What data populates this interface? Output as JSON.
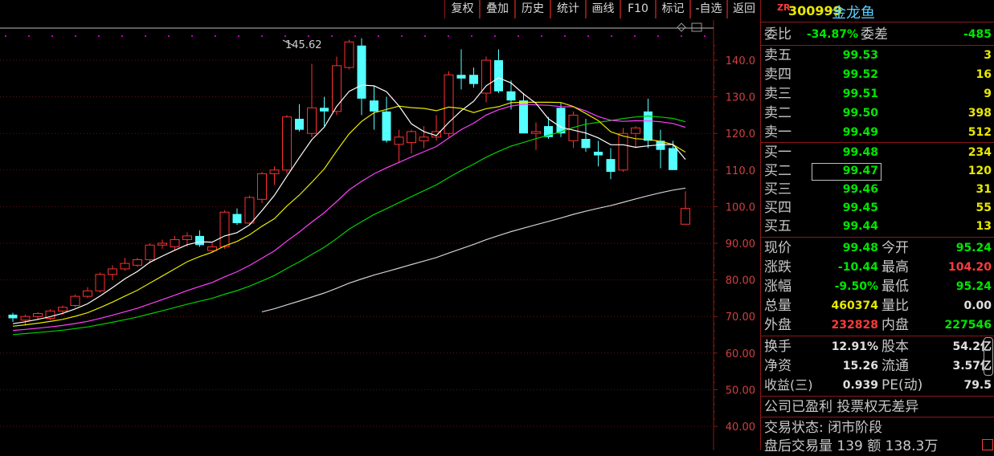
{
  "toolbar": {
    "buttons": [
      {
        "label": "复权",
        "name": "fuquan-button"
      },
      {
        "label": "叠加",
        "name": "diejia-button"
      },
      {
        "label": "历史",
        "name": "lishi-button"
      },
      {
        "label": "统计",
        "name": "tongji-button"
      },
      {
        "label": "画线",
        "name": "huaxian-button"
      },
      {
        "label": "F10",
        "name": "f10-button"
      },
      {
        "label": "标记",
        "name": "biaoji-button"
      },
      {
        "label": "-自选",
        "name": "zixuan-button"
      },
      {
        "label": "返回",
        "name": "fanhui-button"
      }
    ]
  },
  "stock": {
    "tag": "ZR",
    "code": "300999",
    "name": "金龙鱼"
  },
  "order_book": {
    "ratio_label": "委比",
    "ratio_value": "-34.87%",
    "diff_label": "委差",
    "diff_value": "-485",
    "asks": [
      {
        "label": "卖五",
        "price": "99.53",
        "vol": "3"
      },
      {
        "label": "卖四",
        "price": "99.52",
        "vol": "16"
      },
      {
        "label": "卖三",
        "price": "99.51",
        "vol": "9"
      },
      {
        "label": "卖二",
        "price": "99.50",
        "vol": "398"
      },
      {
        "label": "卖一",
        "price": "99.49",
        "vol": "512"
      }
    ],
    "bids": [
      {
        "label": "买一",
        "price": "99.48",
        "vol": "234"
      },
      {
        "label": "买二",
        "price": "99.47",
        "vol": "120"
      },
      {
        "label": "买三",
        "price": "99.46",
        "vol": "31"
      },
      {
        "label": "买四",
        "price": "99.45",
        "vol": "55"
      },
      {
        "label": "买五",
        "price": "99.44",
        "vol": "13"
      }
    ]
  },
  "quote": {
    "rows": [
      {
        "l1": "现价",
        "v1": "99.48",
        "l2": "今开",
        "v2": "95.24"
      },
      {
        "l1": "涨跌",
        "v1": "-10.44",
        "l2": "最高",
        "v2": "104.20"
      },
      {
        "l1": "涨幅",
        "v1": "-9.50%",
        "l2": "最低",
        "v2": "95.24"
      },
      {
        "l1": "总量",
        "v1": "460374",
        "l2": "量比",
        "v2": "0.00"
      },
      {
        "l1": "外盘",
        "v1": "232828",
        "l2": "内盘",
        "v2": "227546"
      }
    ],
    "rows2": [
      {
        "l1": "换手",
        "v1": "12.91%",
        "l2": "股本",
        "v2": "54.2亿"
      },
      {
        "l1": "净资",
        "v1": "15.26",
        "l2": "流通",
        "v2": "3.57亿"
      },
      {
        "l1": "收益(三)",
        "v1": "0.939",
        "l2": "PE(动)",
        "v2": "79.5"
      }
    ],
    "info1": "公司已盈利 投票权无差异",
    "info2": "交易状态: 闭市阶段",
    "info3": "盘后交易量 139 额 138.3万"
  },
  "chart_data": {
    "type": "candlestick",
    "y_ticks": [
      "140.0",
      "130.0",
      "120.0",
      "110.0",
      "100.0",
      "90.00",
      "80.00",
      "70.00",
      "60.00",
      "50.00",
      "40.00"
    ],
    "y_tick_values": [
      140,
      130,
      120,
      110,
      100,
      90,
      80,
      70,
      60,
      50,
      40
    ],
    "ylim": [
      36.5,
      150
    ],
    "high_label": "145.62",
    "colors": {
      "up": "#ff3030",
      "down": "#54ffff",
      "ma5": "#ffffff",
      "ma10": "#e8e800",
      "ma20": "#ff40ff",
      "ma30": "#00d000",
      "ma60": "#d0d0d0"
    },
    "candles": [
      [
        70.5,
        71.0,
        68.5,
        69.5
      ],
      [
        69.0,
        70.5,
        67.5,
        70.0
      ],
      [
        70.0,
        71.2,
        69.0,
        70.8
      ],
      [
        69.5,
        72.0,
        69.0,
        71.5
      ],
      [
        71.5,
        73.0,
        70.5,
        72.5
      ],
      [
        73.0,
        76.0,
        72.5,
        75.5
      ],
      [
        75.5,
        78.0,
        75.0,
        77.0
      ],
      [
        77.0,
        82.0,
        76.5,
        81.5
      ],
      [
        81.5,
        84.0,
        80.0,
        83.0
      ],
      [
        83.0,
        86.0,
        82.5,
        84.5
      ],
      [
        84.0,
        86.0,
        83.5,
        85.5
      ],
      [
        85.5,
        90.0,
        84.5,
        89.5
      ],
      [
        89.5,
        91.0,
        88.5,
        90.0
      ],
      [
        89.0,
        92.0,
        88.0,
        91.0
      ],
      [
        91.0,
        93.0,
        89.0,
        92.0
      ],
      [
        92.0,
        93.5,
        89.0,
        89.5
      ],
      [
        88.0,
        90.0,
        87.5,
        89.0
      ],
      [
        89.0,
        99.0,
        88.5,
        98.5
      ],
      [
        98.0,
        99.5,
        95.0,
        95.5
      ],
      [
        95.5,
        103.0,
        95.0,
        102.5
      ],
      [
        102.0,
        109.5,
        101.0,
        109.0
      ],
      [
        109.0,
        111.0,
        106.0,
        110.0
      ],
      [
        110.0,
        125.0,
        109.0,
        124.5
      ],
      [
        124.0,
        128.0,
        120.5,
        121.0
      ],
      [
        120.0,
        139.0,
        119.0,
        127.0
      ],
      [
        127.0,
        130.0,
        122.0,
        126.0
      ],
      [
        126.0,
        141.0,
        125.0,
        138.5
      ],
      [
        138.0,
        145.6,
        137.5,
        145.0
      ],
      [
        144.0,
        146.0,
        125.0,
        129.5
      ],
      [
        129.0,
        133.0,
        121.0,
        126.0
      ],
      [
        126.0,
        130.0,
        117.5,
        118.0
      ],
      [
        117.0,
        121.0,
        112.0,
        119.0
      ],
      [
        117.5,
        121.0,
        114.5,
        120.5
      ],
      [
        118.0,
        122.0,
        116.0,
        119.0
      ],
      [
        119.0,
        125.0,
        118.0,
        120.5
      ],
      [
        120.0,
        137.0,
        119.0,
        136.0
      ],
      [
        136.0,
        143.0,
        132.0,
        135.0
      ],
      [
        136.0,
        138.0,
        132.5,
        133.5
      ],
      [
        131.0,
        141.0,
        128.5,
        140.0
      ],
      [
        140.0,
        143.0,
        131.0,
        131.5
      ],
      [
        131.5,
        134.5,
        126.5,
        129.0
      ],
      [
        129.0,
        131.0,
        120.0,
        120.0
      ],
      [
        120.0,
        123.0,
        115.5,
        120.5
      ],
      [
        122.0,
        124.5,
        118.5,
        119.0
      ],
      [
        127.0,
        128.5,
        119.0,
        120.0
      ],
      [
        118.0,
        126.0,
        116.0,
        125.0
      ],
      [
        118.5,
        124.0,
        115.0,
        116.0
      ],
      [
        115.0,
        118.0,
        111.0,
        114.0
      ],
      [
        113.0,
        116.0,
        107.5,
        109.5
      ],
      [
        110.0,
        121.5,
        109.5,
        120.0
      ],
      [
        120.0,
        122.0,
        116.0,
        121.5
      ],
      [
        126.0,
        129.5,
        116.0,
        118.0
      ],
      [
        118.0,
        121.0,
        110.5,
        115.5
      ],
      [
        116.0,
        118.0,
        110.0,
        110.0
      ],
      [
        95.2,
        104.2,
        95.2,
        99.5
      ]
    ]
  }
}
